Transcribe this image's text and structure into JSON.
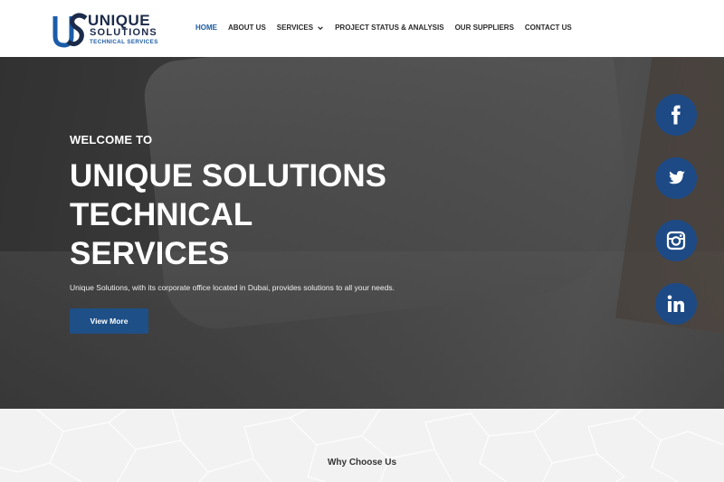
{
  "logo": {
    "mark": "US",
    "line1": "UNIQUE",
    "line2": "SOLUTIONS",
    "line3": "TECHNICAL SERVICES"
  },
  "nav": {
    "items": [
      {
        "label": "HOME",
        "active": true
      },
      {
        "label": "ABOUT US",
        "active": false
      },
      {
        "label": "SERVICES",
        "active": false,
        "has_dropdown": true
      },
      {
        "label": "PROJECT STATUS & ANALYSIS",
        "active": false
      },
      {
        "label": "OUR SUPPLIERS",
        "active": false
      },
      {
        "label": "CONTACT US",
        "active": false
      }
    ]
  },
  "hero": {
    "welcome": "WELCOME TO",
    "title_lines": [
      "UNIQUE SOLUTIONS",
      "TECHNICAL",
      "SERVICES"
    ],
    "description": "Unique Solutions, with its corporate office located in Dubai, provides solutions to all your needs.",
    "button_label": "View More"
  },
  "social": [
    {
      "icon": "facebook-icon"
    },
    {
      "icon": "twitter-icon"
    },
    {
      "icon": "instagram-icon"
    },
    {
      "icon": "linkedin-icon"
    }
  ],
  "section": {
    "heading": "Why Choose Us"
  },
  "colors": {
    "brand_dark": "#1c2b4a",
    "brand_blue": "#1e4f86",
    "nav_active": "#1b5aa0",
    "social_bg": "#1d4a85"
  }
}
